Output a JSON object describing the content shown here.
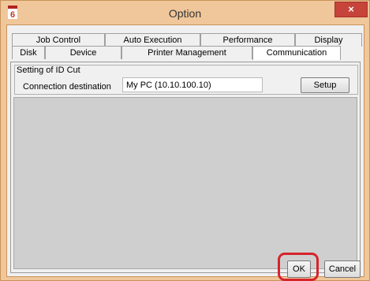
{
  "window": {
    "title": "Option",
    "close_label": "×",
    "app_icon": "app-logo-icon"
  },
  "tabs": {
    "back_row": [
      "Job Control",
      "Auto Execution",
      "Performance",
      "Display"
    ],
    "front_row": [
      "Disk",
      "Device",
      "Printer Management",
      "Communication"
    ],
    "active": "Communication"
  },
  "group": {
    "title": "Setting of ID Cut",
    "connection_label": "Connection destination",
    "connection_value": "My PC (10.10.100.10)",
    "setup_label": "Setup"
  },
  "footer": {
    "ok_label": "OK",
    "cancel_label": "Cancel"
  },
  "colors": {
    "title_bar": "#f0c79a",
    "close_button": "#c7443b",
    "highlight": "#d6242b"
  }
}
